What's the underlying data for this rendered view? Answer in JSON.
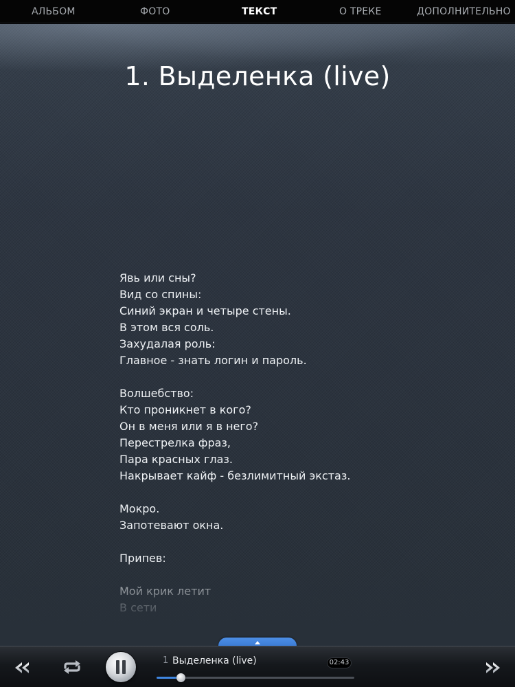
{
  "tabs": [
    "АЛЬБОМ",
    "ФОТО",
    "ТЕКСТ",
    "О ТРЕКЕ",
    "ДОПОЛНИТЕЛЬНО"
  ],
  "active_tab_index": 2,
  "track_title": "1. Выделенка (live)",
  "lyrics": [
    "Явь или сны?",
    "Вид со спины:",
    "Синий экран и четыре стены.",
    "В этом вся соль.",
    "Захудалая роль:",
    "Главное - знать логин и пароль.",
    "",
    "Волшебство:",
    "Кто проникнет в кого?",
    "Он в меня или я в него?",
    "Перестрелка фраз,",
    "Пара красных глаз.",
    "Накрывает кайф - безлимитный экстаз.",
    "",
    "Мокро.",
    "Запотевают окна.",
    "",
    "Припев:",
    "",
    "Мой крик летит",
    "В сети"
  ],
  "player": {
    "track_number": "1",
    "track_name": "Выделенка (live)",
    "time": "02:43",
    "progress_fraction": 0.12
  },
  "colors": {
    "accent": "#3f86e0",
    "active_tab": "#ffffff",
    "inactive_tab": "#a8acb1"
  },
  "icons": {
    "prev": "rewind-icon",
    "repeat": "repeat-icon",
    "pause": "pause-icon",
    "next": "fast-forward-icon",
    "expand": "chevron-up-icon"
  }
}
